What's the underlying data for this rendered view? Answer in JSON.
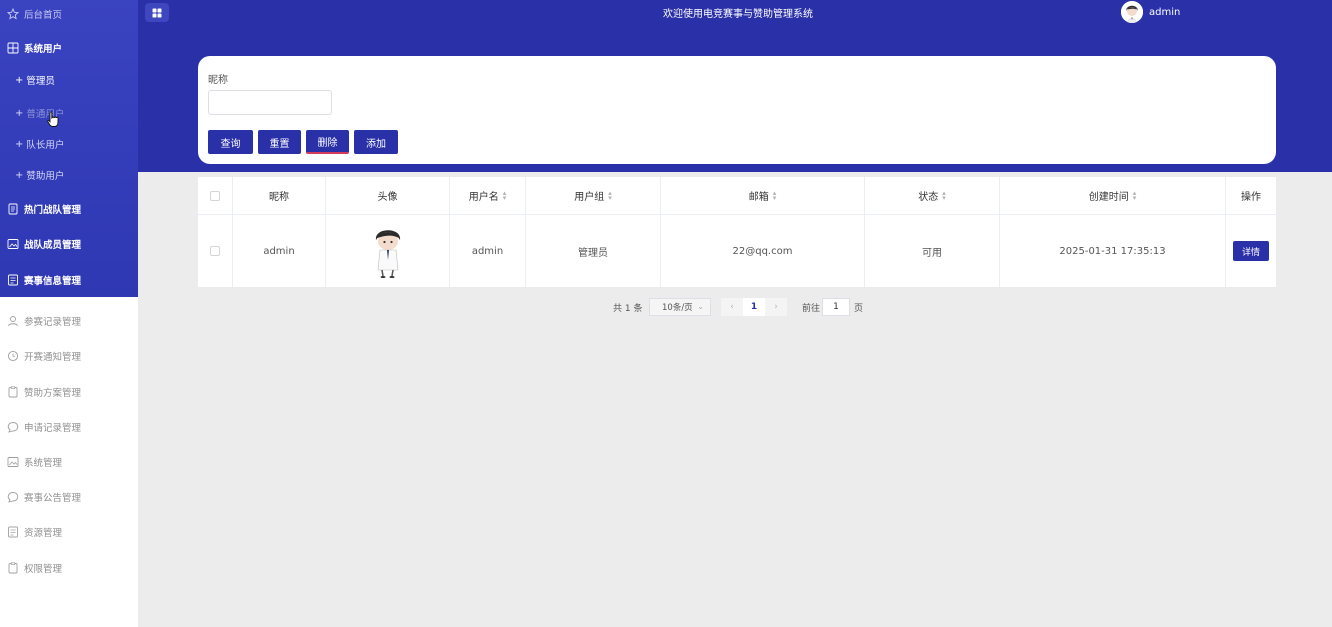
{
  "app": {
    "title": "欢迎使用电竞赛事与赞助管理系统",
    "user_name": "admin",
    "brand_color": "#2a30a8"
  },
  "sidebar": {
    "items": [
      {
        "label": "后台首页",
        "icon": "star-icon",
        "kind": "top-dim"
      },
      {
        "label": "系统用户",
        "icon": "grid-icon",
        "kind": "top"
      },
      {
        "label": "管理员",
        "kind": "sub-active"
      },
      {
        "label": "普通用户",
        "kind": "sub-hover"
      },
      {
        "label": "队长用户",
        "kind": "sub"
      },
      {
        "label": "赞助用户",
        "kind": "sub"
      },
      {
        "label": "热门战队管理",
        "icon": "document-icon",
        "kind": "top"
      },
      {
        "label": "战队成员管理",
        "icon": "image-icon",
        "kind": "top"
      },
      {
        "label": "赛事信息管理",
        "icon": "list-icon",
        "kind": "top"
      },
      {
        "label": "参赛记录管理",
        "icon": "user-icon",
        "kind": "low"
      },
      {
        "label": "开赛通知管理",
        "icon": "clock-icon",
        "kind": "low"
      },
      {
        "label": "赞助方案管理",
        "icon": "clipboard-icon",
        "kind": "low"
      },
      {
        "label": "申请记录管理",
        "icon": "chat-icon",
        "kind": "low"
      },
      {
        "label": "系统管理",
        "icon": "image-icon",
        "kind": "low"
      },
      {
        "label": "赛事公告管理",
        "icon": "chat-icon",
        "kind": "low"
      },
      {
        "label": "资源管理",
        "icon": "list-icon",
        "kind": "low"
      },
      {
        "label": "权限管理",
        "icon": "clipboard-icon",
        "kind": "low"
      }
    ]
  },
  "search": {
    "nickname_label": "昵称",
    "nickname_value": "",
    "nickname_placeholder": "",
    "buttons": {
      "query": "查询",
      "reset": "重置",
      "delete": "删除",
      "add": "添加"
    }
  },
  "table": {
    "columns": [
      "昵称",
      "头像",
      "用户名",
      "用户组",
      "邮箱",
      "状态",
      "创建时间",
      "操作"
    ],
    "rows": [
      {
        "nickname": "admin",
        "username": "admin",
        "group": "管理员",
        "email": "22@qq.com",
        "status": "可用",
        "created": "2025-01-31 17:35:13",
        "action": "详情"
      }
    ]
  },
  "pagination": {
    "total_text": "共 1 条",
    "page_size": "10条/页",
    "current_page": "1",
    "goto_label": "前往",
    "goto_value": "1",
    "page_unit": "页",
    "prev_icon": "chevron-left-icon",
    "next_icon": "chevron-right-icon"
  }
}
